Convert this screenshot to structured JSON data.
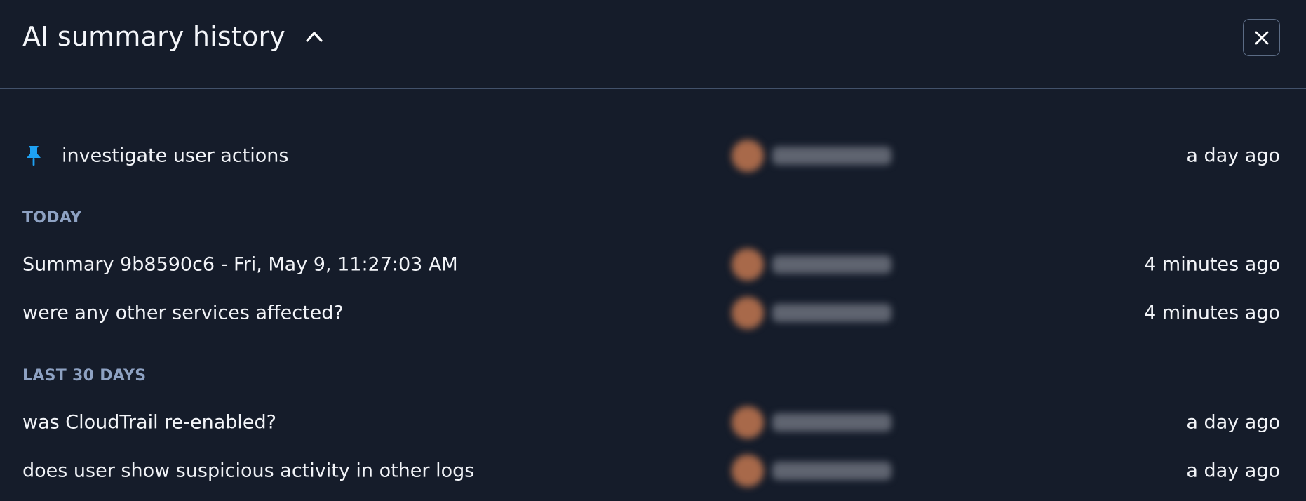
{
  "header": {
    "title": "AI summary history"
  },
  "pinned": {
    "label": "investigate user actions",
    "time": "a day ago"
  },
  "groups": [
    {
      "title": "TODAY",
      "items": [
        {
          "label": "Summary 9b8590c6 - Fri, May 9, 11:27:03 AM",
          "time": "4 minutes ago"
        },
        {
          "label": "were any other services affected?",
          "time": "4 minutes ago"
        }
      ]
    },
    {
      "title": "LAST 30 DAYS",
      "items": [
        {
          "label": "was CloudTrail re-enabled?",
          "time": "a day ago"
        },
        {
          "label": "does user show suspicious activity in other logs",
          "time": "a day ago"
        }
      ]
    }
  ],
  "colors": {
    "background": "#151c2a",
    "group_header": "#8ea2c3",
    "pin": "#1ea1f2",
    "divider": "#42516a"
  },
  "icons": {
    "collapse": "chevron-up-icon",
    "close": "close-icon",
    "pin": "pin-icon"
  }
}
